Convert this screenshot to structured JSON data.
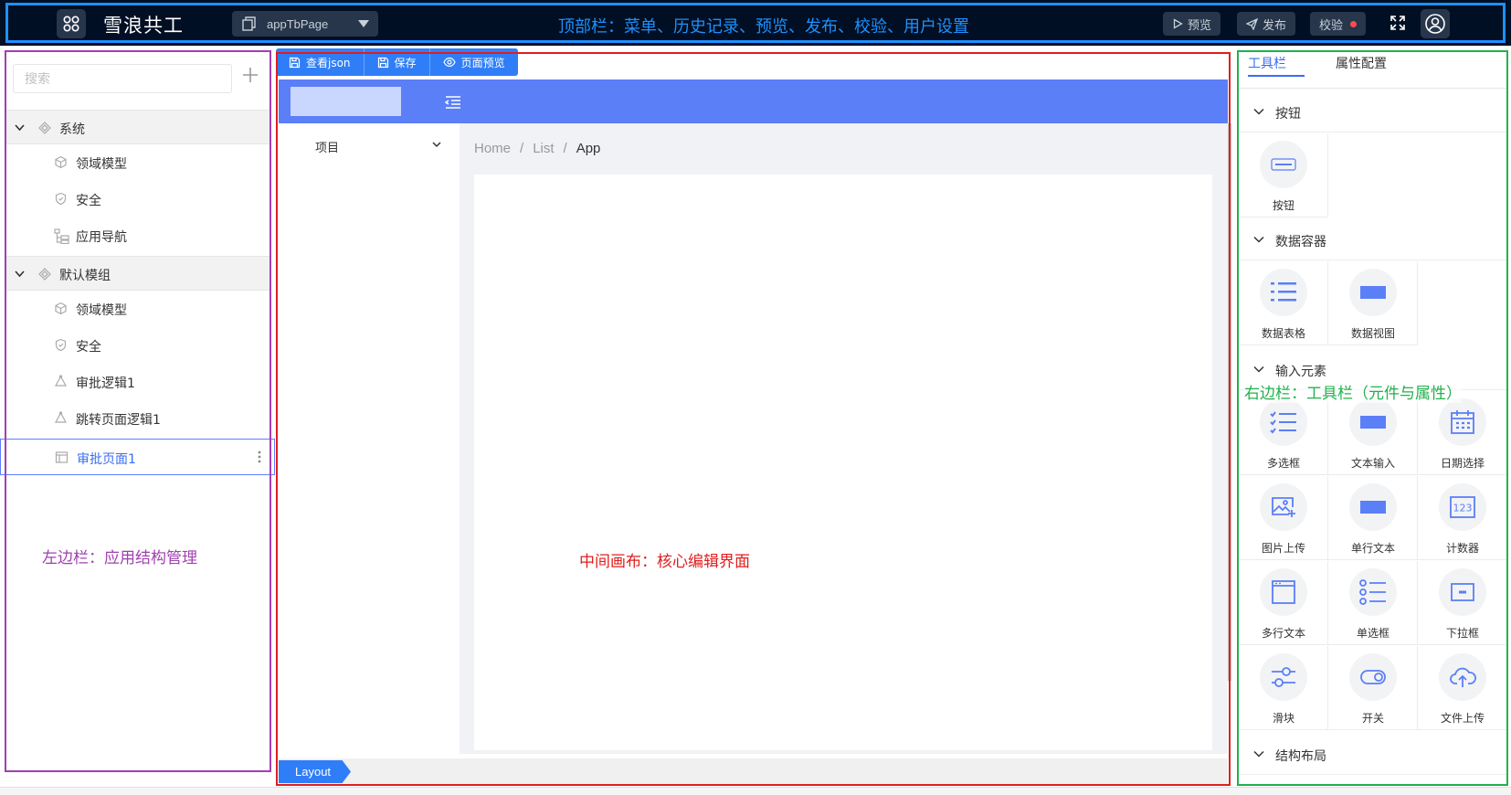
{
  "topbar": {
    "app_title": "雪浪共工",
    "page_select": "appTbPage",
    "annotation": "顶部栏：菜单、历史记录、预览、发布、校验、用户设置",
    "preview": "预览",
    "publish": "发布",
    "verify": "校验"
  },
  "left": {
    "search_placeholder": "搜索",
    "groups": [
      {
        "label": "系统",
        "items": [
          "领域模型",
          "安全",
          "应用导航"
        ]
      },
      {
        "label": "默认模组",
        "items": [
          "领域模型",
          "安全",
          "审批逻辑1",
          "跳转页面逻辑1",
          "审批页面1"
        ]
      }
    ],
    "annotation": "左边栏：应用结构管理"
  },
  "canvas": {
    "toolbar": [
      "查看json",
      "保存",
      "页面预览"
    ],
    "sidemenu_item": "项目",
    "breadcrumb": [
      "Home",
      "List",
      "App"
    ],
    "annotation": "中间画布：核心编辑界面",
    "footer_tag": "Layout"
  },
  "right": {
    "tabs": [
      "工具栏",
      "属性配置"
    ],
    "sections": {
      "button": "按钮",
      "data_container": "数据容器",
      "input": "输入元素",
      "layout": "结构布局"
    },
    "components": {
      "button": [
        "按钮"
      ],
      "data_container": [
        "数据表格",
        "数据视图"
      ],
      "input": [
        "多选框",
        "文本输入",
        "日期选择",
        "图片上传",
        "单行文本",
        "计数器",
        "多行文本",
        "单选框",
        "下拉框",
        "滑块",
        "开关",
        "文件上传"
      ]
    },
    "annotation": "右边栏：工具栏（元件与属性）"
  },
  "colors": {
    "topbar_bg": "#000f23",
    "accent": "#2f7ef7",
    "header_blue": "#5b7ff7",
    "outline_top": "#1e90ff",
    "outline_left": "#a040b0",
    "outline_canvas": "#e01e1e",
    "outline_right": "#22b14c"
  }
}
